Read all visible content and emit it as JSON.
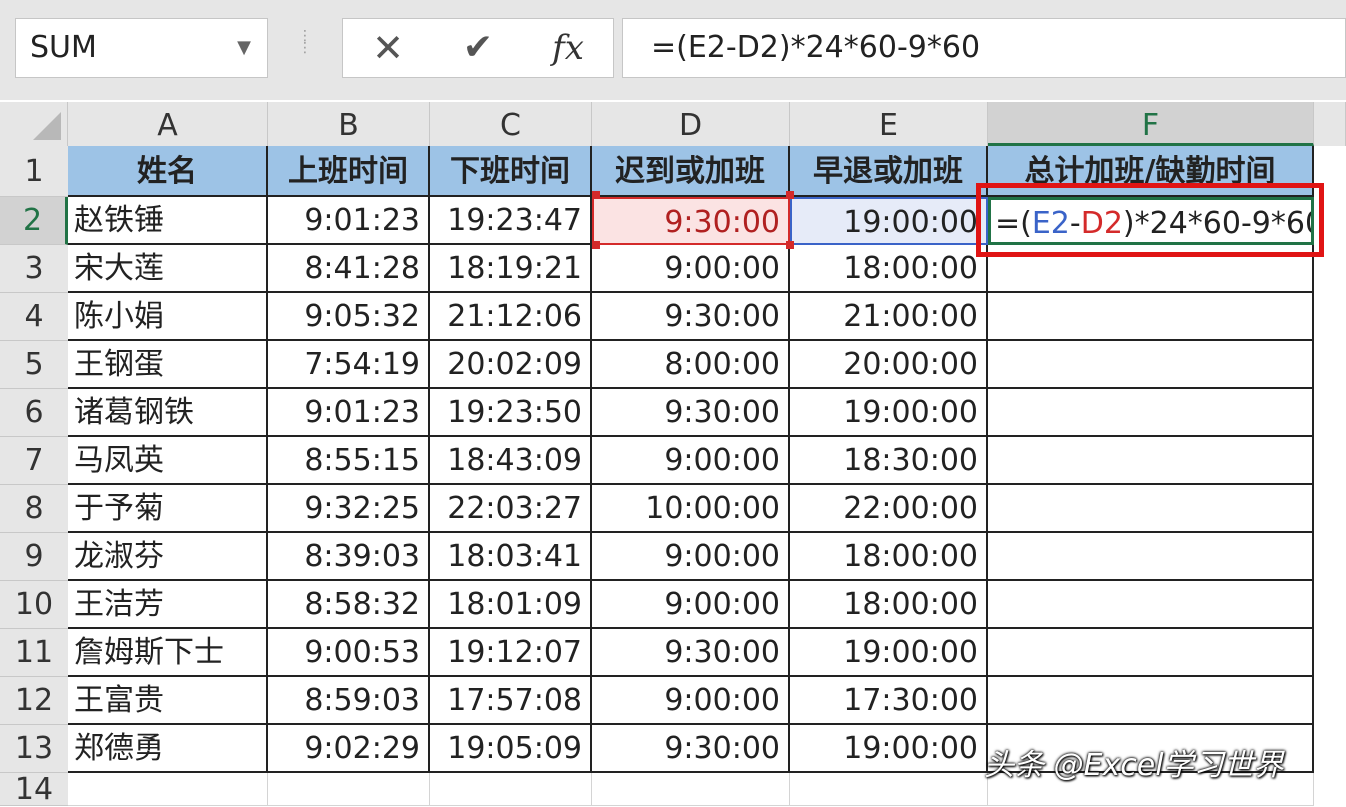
{
  "name_box": {
    "value": "SUM",
    "dropdown_icon": "caret-down-icon"
  },
  "formula_bar": {
    "cancel_icon": "✕",
    "enter_icon": "✔",
    "fx_label": "fx",
    "formula": "=(E2-D2)*24*60-9*60"
  },
  "columns": [
    "A",
    "B",
    "C",
    "D",
    "E",
    "F"
  ],
  "rows": [
    "1",
    "2",
    "3",
    "4",
    "5",
    "6",
    "7",
    "8",
    "9",
    "10",
    "11",
    "12",
    "13",
    "14"
  ],
  "headers": [
    "姓名",
    "上班时间",
    "下班时间",
    "迟到或加班",
    "早退或加班",
    "总计加班/缺勤时间"
  ],
  "data": [
    [
      "赵铁锤",
      "9:01:23",
      "19:23:47",
      "9:30:00",
      "19:00:00"
    ],
    [
      "宋大莲",
      "8:41:28",
      "18:19:21",
      "9:00:00",
      "18:00:00"
    ],
    [
      "陈小娟",
      "9:05:32",
      "21:12:06",
      "9:30:00",
      "21:00:00"
    ],
    [
      "王钢蛋",
      "7:54:19",
      "20:02:09",
      "8:00:00",
      "20:00:00"
    ],
    [
      "诸葛钢铁",
      "9:01:23",
      "19:23:50",
      "9:30:00",
      "19:00:00"
    ],
    [
      "马凤英",
      "8:55:15",
      "18:43:09",
      "9:00:00",
      "18:30:00"
    ],
    [
      "于予菊",
      "9:32:25",
      "22:03:27",
      "10:00:00",
      "22:00:00"
    ],
    [
      "龙淑芬",
      "8:39:03",
      "18:03:41",
      "9:00:00",
      "18:00:00"
    ],
    [
      "王洁芳",
      "8:58:32",
      "18:01:09",
      "9:00:00",
      "18:00:00"
    ],
    [
      "詹姆斯下士",
      "9:00:53",
      "19:12:07",
      "9:30:00",
      "19:00:00"
    ],
    [
      "王富贵",
      "8:59:03",
      "17:57:08",
      "9:00:00",
      "17:30:00"
    ],
    [
      "郑德勇",
      "9:02:29",
      "19:05:09",
      "9:30:00",
      "19:00:00"
    ]
  ],
  "edit_cell": {
    "p1": "=(",
    "ref1": "E2",
    "op": "-",
    "ref2": "D2",
    "rest": ")*24*60-9*60"
  },
  "watermark": "头条 @Excel学习世界",
  "colors": {
    "header_fill": "#9dc3e6",
    "selection_green": "#217346",
    "ref_red": "#d42a2a",
    "ref_blue": "#3a63c8",
    "highlight_box": "#e01414"
  }
}
